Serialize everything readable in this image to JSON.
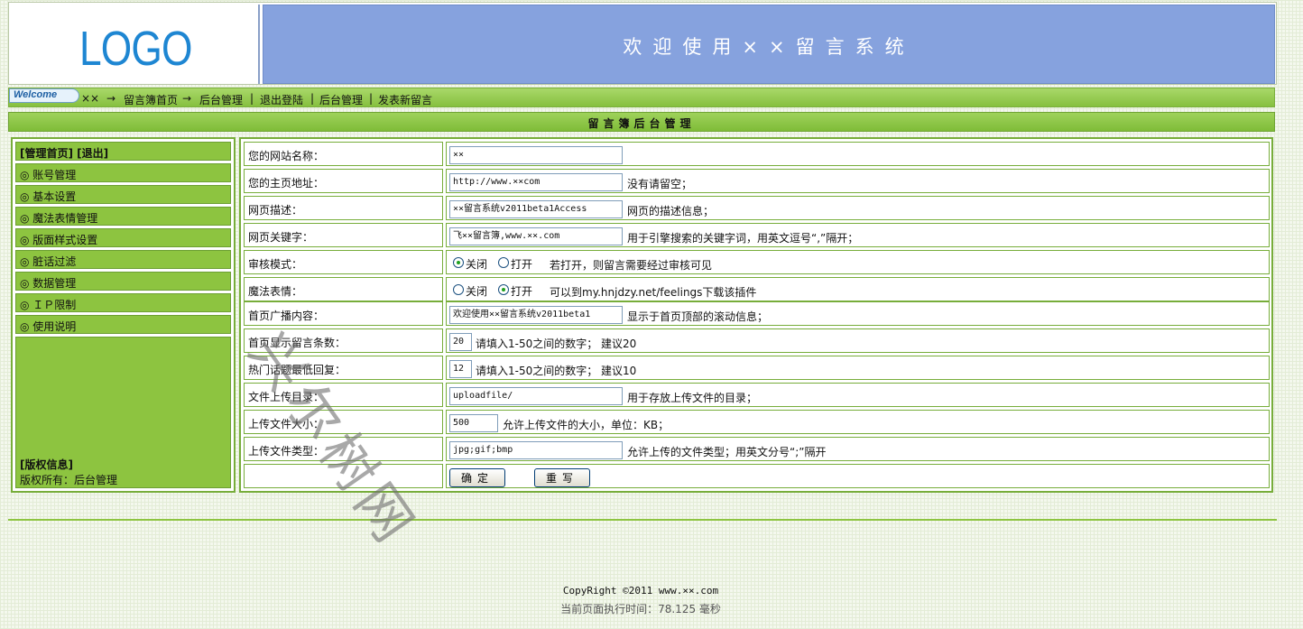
{
  "header": {
    "logo_text": "LOGO",
    "banner_title": "欢迎使用××留言系统"
  },
  "nav": {
    "welcome": "Welcome",
    "site": "××",
    "arrow1": "→",
    "home": "留言簿首页",
    "arrow2": "→",
    "admin": "后台管理",
    "logout": "退出登陆",
    "admin2": "后台管理",
    "post_new": "发表新留言",
    "sep": "|"
  },
  "page_title": "留言簿后台管理",
  "sidebar": {
    "head": "[管理首页] [退出]",
    "items": [
      {
        "label": "◎ 账号管理"
      },
      {
        "label": "◎ 基本设置"
      },
      {
        "label": "◎ 魔法表情管理"
      },
      {
        "label": "◎ 版面样式设置"
      },
      {
        "label": "◎ 脏话过滤"
      },
      {
        "label": "◎ 数据管理"
      },
      {
        "label": "◎ ＩＰ限制"
      },
      {
        "label": "◎ 使用说明"
      }
    ],
    "copyright_title": "[版权信息]",
    "copyright_text": "版权所有：后台管理"
  },
  "form": {
    "rows": [
      {
        "label": "您的网站名称：",
        "value": "××",
        "hint": ""
      },
      {
        "label": "您的主页地址：",
        "value": "http://www.××com",
        "hint": "没有请留空；"
      },
      {
        "label": "网页描述：",
        "value": "××留言系统v2011beta1Access",
        "hint": "网页的描述信息；"
      },
      {
        "label": "网页关键字：",
        "value": "飞××留言簿,www.××.com",
        "hint": "用于引擎搜索的关键字词，用英文逗号“,”隔开；"
      },
      {
        "label": "审核模式：",
        "opt_off": "关闭",
        "opt_on": "打开",
        "selected": "关闭",
        "hint": "若打开，则留言需要经过审核可见"
      },
      {
        "label": "魔法表情：",
        "opt_off": "关闭",
        "opt_on": "打开",
        "selected": "打开",
        "hint": "可以到my.hnjdzy.net/feelings下载该插件"
      },
      {
        "label": "首页广播内容：",
        "value": "欢迎使用××留言系统v2011beta1",
        "hint": "显示于首页顶部的滚动信息；"
      },
      {
        "label": "首页显示留言条数：",
        "value": "20",
        "hint": "请填入1-50之间的数字； 建议20"
      },
      {
        "label": "热门话题最低回复：",
        "value": "12",
        "hint": "请填入1-50之间的数字； 建议10"
      },
      {
        "label": "文件上传目录：",
        "value": "uploadfile/",
        "hint": "用于存放上传文件的目录；"
      },
      {
        "label": "上传文件大小：",
        "value": "500",
        "hint": "允许上传文件的大小，单位：KB；"
      },
      {
        "label": "上传文件类型：",
        "value": "jpg;gif;bmp",
        "hint": "允许上传的文件类型；用英文分号“;”隔开"
      }
    ],
    "submit_label": "确定",
    "reset_label": "重写"
  },
  "footer": {
    "copyright": "CopyRight ©2011 www.××.com",
    "exec_time": "当前页面执行时间：78.125 毫秒"
  },
  "watermark": "兴尔树网",
  "colors": {
    "green_accent": "#8dc440",
    "banner_blue": "#86a2de",
    "logo_blue": "#1e86d2"
  }
}
